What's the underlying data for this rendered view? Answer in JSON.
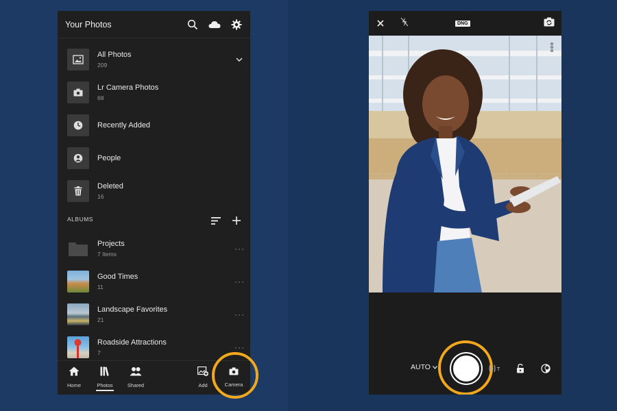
{
  "left_app": {
    "header": {
      "title": "Your Photos",
      "icons": [
        "search-icon",
        "cloud-icon",
        "gear-icon"
      ]
    },
    "library": [
      {
        "title": "All Photos",
        "sub": "209",
        "icon": "image-icon"
      },
      {
        "title": "Lr Camera Photos",
        "sub": "68",
        "icon": "camera-icon"
      },
      {
        "title": "Recently Added",
        "sub": "",
        "icon": "clock-icon"
      },
      {
        "title": "People",
        "sub": "",
        "icon": "person-icon"
      },
      {
        "title": "Deleted",
        "sub": "16",
        "icon": "trash-icon"
      }
    ],
    "albums_label": "ALBUMS",
    "albums": [
      {
        "title": "Projects",
        "sub": "7 Items"
      },
      {
        "title": "Good Times",
        "sub": "11"
      },
      {
        "title": "Landscape Favorites",
        "sub": "21"
      },
      {
        "title": "Roadside Attractions",
        "sub": "7"
      }
    ],
    "nav": [
      {
        "label": "Home",
        "icon": "home-icon"
      },
      {
        "label": "Photos",
        "icon": "photos-icon",
        "active": true
      },
      {
        "label": "Shared",
        "icon": "shared-icon"
      },
      {
        "label": "Add",
        "icon": "add-photo-icon"
      },
      {
        "label": "Camera",
        "icon": "camera-icon"
      }
    ]
  },
  "right_app": {
    "top": {
      "badge": "DNG",
      "icons": [
        "close-icon",
        "flash-off-icon",
        "switch-camera-icon"
      ]
    },
    "controls": {
      "mode": "AUTO",
      "lens_label": "T"
    }
  },
  "colors": {
    "highlight": "#f2a81d",
    "background": "#1d3a64",
    "panel": "#1f1f1f"
  }
}
